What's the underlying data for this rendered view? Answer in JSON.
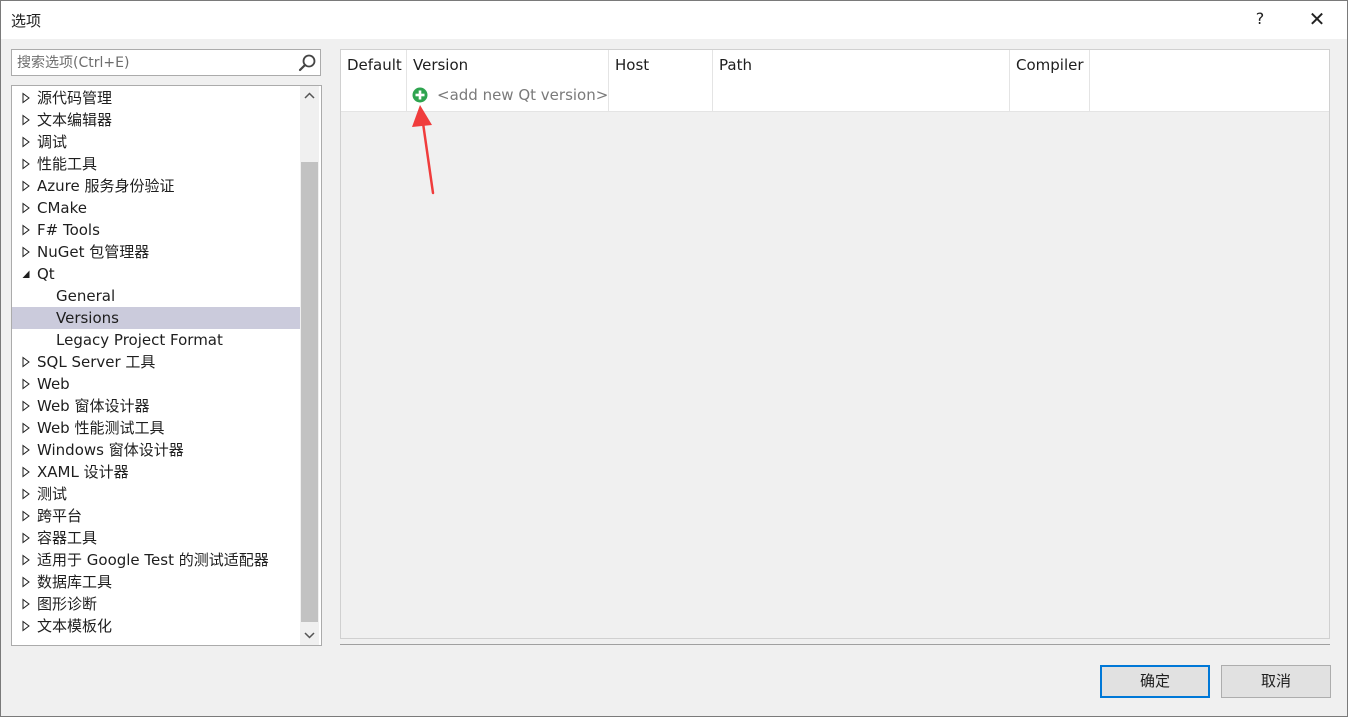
{
  "window": {
    "title": "选项",
    "help_label": "?",
    "close_label": "✕"
  },
  "search": {
    "placeholder": "搜索选项(Ctrl+E)",
    "value": ""
  },
  "tree": {
    "items": [
      {
        "label": "源代码管理",
        "level": 0,
        "expanded": false
      },
      {
        "label": "文本编辑器",
        "level": 0,
        "expanded": false
      },
      {
        "label": "调试",
        "level": 0,
        "expanded": false
      },
      {
        "label": "性能工具",
        "level": 0,
        "expanded": false
      },
      {
        "label": "Azure 服务身份验证",
        "level": 0,
        "expanded": false
      },
      {
        "label": "CMake",
        "level": 0,
        "expanded": false
      },
      {
        "label": "F# Tools",
        "level": 0,
        "expanded": false
      },
      {
        "label": "NuGet 包管理器",
        "level": 0,
        "expanded": false
      },
      {
        "label": "Qt",
        "level": 0,
        "expanded": true
      },
      {
        "label": "General",
        "level": 1
      },
      {
        "label": "Versions",
        "level": 1,
        "selected": true
      },
      {
        "label": "Legacy Project Format",
        "level": 1
      },
      {
        "label": "SQL Server 工具",
        "level": 0,
        "expanded": false
      },
      {
        "label": "Web",
        "level": 0,
        "expanded": false
      },
      {
        "label": "Web 窗体设计器",
        "level": 0,
        "expanded": false
      },
      {
        "label": "Web 性能测试工具",
        "level": 0,
        "expanded": false
      },
      {
        "label": "Windows 窗体设计器",
        "level": 0,
        "expanded": false
      },
      {
        "label": "XAML 设计器",
        "level": 0,
        "expanded": false
      },
      {
        "label": "测试",
        "level": 0,
        "expanded": false
      },
      {
        "label": "跨平台",
        "level": 0,
        "expanded": false
      },
      {
        "label": "容器工具",
        "level": 0,
        "expanded": false
      },
      {
        "label": "适用于 Google Test 的测试适配器",
        "level": 0,
        "expanded": false
      },
      {
        "label": "数据库工具",
        "level": 0,
        "expanded": false
      },
      {
        "label": "图形诊断",
        "level": 0,
        "expanded": false
      },
      {
        "label": "文本模板化",
        "level": 0,
        "expanded": false
      }
    ]
  },
  "grid": {
    "columns": [
      "Default",
      "Version",
      "Host",
      "Path",
      "Compiler"
    ],
    "add_row_label": "<add new Qt version>"
  },
  "buttons": {
    "ok": "确定",
    "cancel": "取消"
  },
  "colors": {
    "selection": "#cbcbdc",
    "add_icon": "#2ea44f",
    "annotation_arrow": "#f03c3c",
    "ok_border": "#0078d7"
  },
  "icons": {
    "search": "search-icon",
    "add": "plus-circle-icon",
    "tree_collapsed": "triangle-right-outline-icon",
    "tree_expanded": "triangle-down-filled-icon"
  }
}
